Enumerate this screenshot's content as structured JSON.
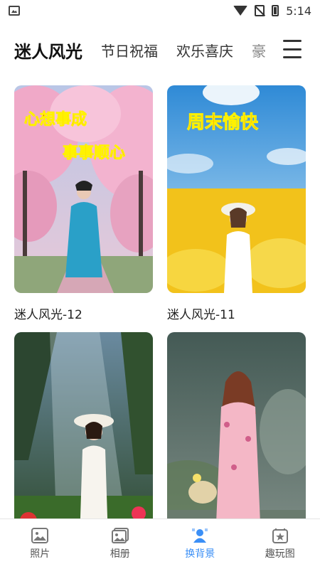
{
  "status_bar": {
    "time": "5:14"
  },
  "tabs": [
    {
      "label": "迷人风光",
      "active": true
    },
    {
      "label": "节日祝福"
    },
    {
      "label": "欢乐喜庆"
    },
    {
      "label": "豪"
    }
  ],
  "cards": [
    {
      "title": "迷人风光-12",
      "overlay_line1": "心想事成",
      "overlay_line2": "事事顺心"
    },
    {
      "title": "迷人风光-11",
      "overlay_line1": "周末愉快"
    },
    {
      "title": ""
    },
    {
      "title": ""
    }
  ],
  "bottom_nav": [
    {
      "label": "照片",
      "icon": "photo-icon"
    },
    {
      "label": "相册",
      "icon": "album-icon"
    },
    {
      "label": "换背景",
      "icon": "person-icon",
      "active": true
    },
    {
      "label": "趣玩图",
      "icon": "star-card-icon"
    }
  ],
  "colors": {
    "accent": "#3b8ff6",
    "text": "#222222"
  }
}
